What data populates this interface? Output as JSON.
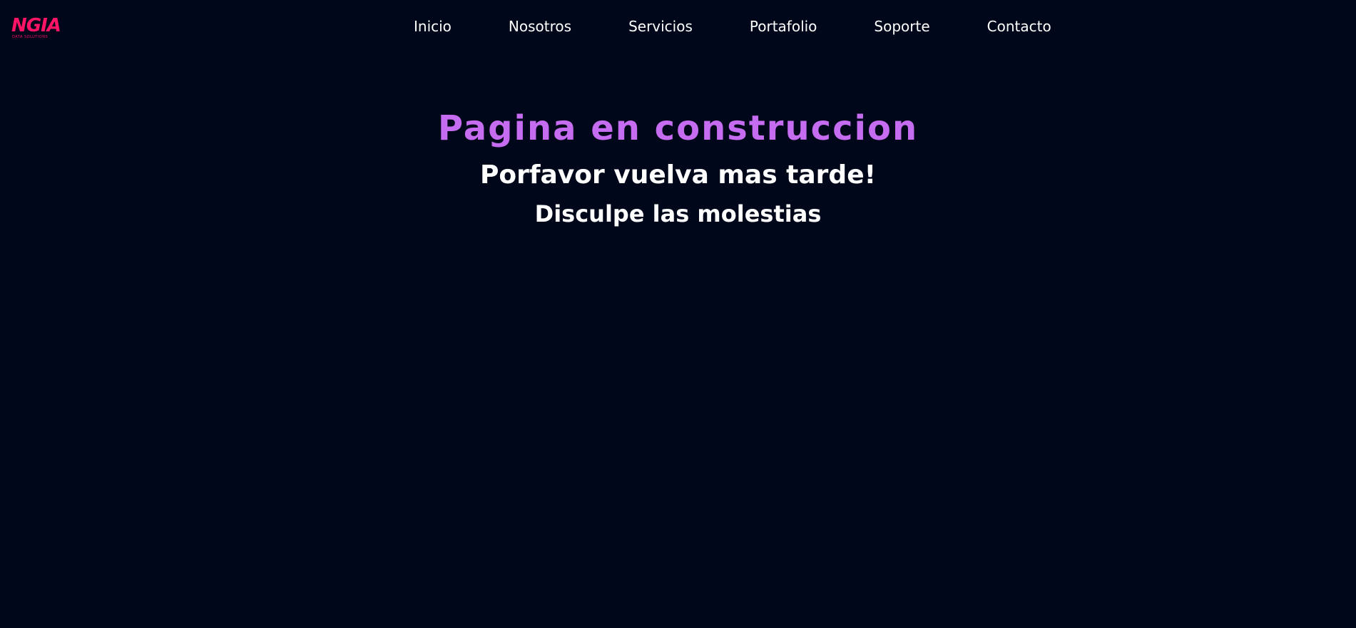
{
  "logo": {
    "text": "NGIA",
    "tagline": "DATA SOLUTIONS",
    "color": "#ff1466"
  },
  "nav": {
    "items": [
      {
        "label": "Inicio"
      },
      {
        "label": "Nosotros"
      },
      {
        "label": "Servicios"
      },
      {
        "label": "Portafolio"
      },
      {
        "label": "Soporte"
      },
      {
        "label": "Contacto"
      }
    ]
  },
  "main": {
    "title": "Pagina en construccion",
    "subtitle": "Porfavor vuelva mas tarde!",
    "message": "Disculpe las molestias"
  },
  "colors": {
    "background": "#00071a",
    "accent": "#c56cf0",
    "text": "#ffffff",
    "brand": "#ff1466"
  }
}
